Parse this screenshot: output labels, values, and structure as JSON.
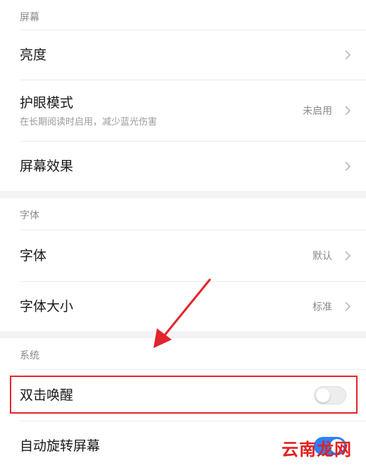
{
  "sections": [
    {
      "header": "屏幕",
      "items": [
        {
          "title": "亮度"
        },
        {
          "title": "护眼模式",
          "subtitle": "在长期阅读时启用，减少蓝光伤害",
          "value": "未启用"
        },
        {
          "title": "屏幕效果"
        }
      ]
    },
    {
      "header": "字体",
      "items": [
        {
          "title": "字体",
          "value": "默认"
        },
        {
          "title": "字体大小",
          "value": "标准"
        }
      ]
    },
    {
      "header": "系统",
      "items": [
        {
          "title": "双击唤醒",
          "toggle_state": "off"
        },
        {
          "title": "自动旋转屏幕",
          "toggle_state": "on"
        }
      ]
    }
  ],
  "watermark": "云南龙网",
  "colors": {
    "highlight": "#e2242d",
    "toggle_on": "#2f80ff",
    "toggle_off": "#ededed"
  }
}
